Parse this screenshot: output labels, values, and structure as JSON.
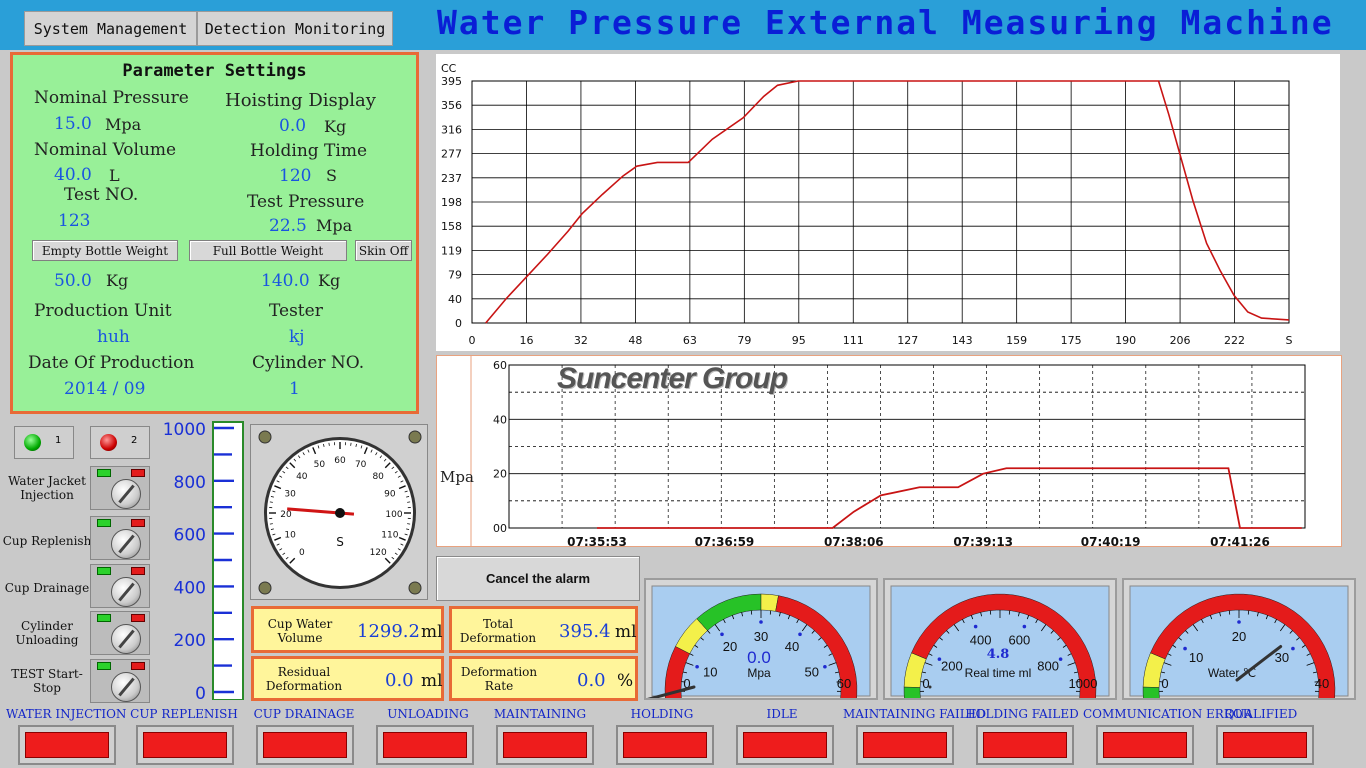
{
  "menu": {
    "system_management": "System Management",
    "detection_monitoring": "Detection Monitoring"
  },
  "app_title": "Water Pressure External Measuring Machine",
  "params": {
    "title": "Parameter Settings",
    "nominal_pressure_label": "Nominal Pressure",
    "nominal_pressure_value": "15.0",
    "nominal_pressure_unit": "Mpa",
    "hoisting_display_label": "Hoisting Display",
    "hoisting_display_value": "0.0",
    "hoisting_display_unit": "Kg",
    "nominal_volume_label": "Nominal Volume",
    "nominal_volume_value": "40.0",
    "nominal_volume_unit": "L",
    "holding_time_label": "Holding Time",
    "holding_time_value": "120",
    "holding_time_unit": "S",
    "test_no_label": "Test NO.",
    "test_no_value": "123",
    "test_pressure_label": "Test Pressure",
    "test_pressure_value": "22.5",
    "test_pressure_unit": "Mpa",
    "empty_bottle_btn": "Empty Bottle Weight",
    "full_bottle_btn": "Full Bottle Weight",
    "skin_off_btn": "Skin Off",
    "empty_bottle_value": "50.0",
    "empty_bottle_unit": "Kg",
    "full_bottle_value": "140.0",
    "full_bottle_unit": "Kg",
    "production_unit_label": "Production Unit",
    "production_unit_value": "huh",
    "tester_label": "Tester",
    "tester_value": "kj",
    "date_label": "Date Of Production",
    "date_value": "2014 / 09",
    "cylinder_label": "Cylinder NO.",
    "cylinder_value": "1"
  },
  "controls": {
    "btn1": "1",
    "btn2": "2",
    "items": [
      "Water Jacket Injection",
      "Cup Replenish",
      "Cup Drainage",
      "Cylinder Unloading",
      "TEST Start-Stop"
    ]
  },
  "level_gauge": {
    "ticks": [
      "1000",
      "800",
      "600",
      "400",
      "200",
      "0"
    ]
  },
  "dial": {
    "labels": [
      "0",
      "10",
      "20",
      "30",
      "40",
      "50",
      "60",
      "70",
      "80",
      "90",
      "100",
      "110",
      "120"
    ],
    "unit": "S",
    "value_seconds": 22
  },
  "readouts": {
    "cup_water_volume_label": "Cup Water Volume",
    "cup_water_volume_value": "1299.2",
    "cup_water_volume_unit": "ml",
    "total_deformation_label": "Total Deformation",
    "total_deformation_value": "395.4",
    "total_deformation_unit": "ml",
    "residual_deformation_label": "Residual Deformation",
    "residual_deformation_value": "0.0",
    "residual_deformation_unit": "ml",
    "deformation_rate_label": "Deformation Rate",
    "deformation_rate_value": "0.0",
    "deformation_rate_unit": "%"
  },
  "cancel_alarm": "Cancel the alarm",
  "watermark": "Suncenter Group",
  "gauges": [
    {
      "ticks": [
        "0",
        "10",
        "20",
        "30",
        "40",
        "50",
        "60"
      ],
      "value": "0.0",
      "unit": "Mpa"
    },
    {
      "ticks": [
        "0",
        "200",
        "400",
        "600",
        "800",
        "1000"
      ],
      "value": "4.8",
      "unit": "Real time ml"
    },
    {
      "ticks": [
        "0",
        "10",
        "20",
        "30",
        "40"
      ],
      "unit": "Water ℃"
    }
  ],
  "status": [
    "WATER INJECTION",
    "CUP REPLENISH",
    "CUP DRAINAGE",
    "UNLOADING",
    "MAINTAINING",
    "HOLDING",
    "IDLE",
    "MAINTAINING FAILED",
    "HOLDING FAILED",
    "COMMUNICATION ERROR",
    "QUALIFIED"
  ],
  "status_colors": {
    "lamp": "#ee1c1c",
    "label": "#1326c8"
  },
  "chart_data": [
    {
      "type": "line",
      "ylabel": "CC",
      "xlabel": "S",
      "xlim": [
        0,
        238
      ],
      "ylim": [
        0,
        395
      ],
      "x_ticks": [
        "0",
        "16",
        "32",
        "48",
        "63",
        "79",
        "95",
        "111",
        "127",
        "143",
        "159",
        "175",
        "190",
        "206",
        "222",
        "S"
      ],
      "y_ticks": [
        "395",
        "356",
        "316",
        "277",
        "237",
        "198",
        "158",
        "119",
        "79",
        "40",
        "0"
      ],
      "grid": true,
      "series": [
        {
          "color": "#c81414",
          "x": [
            4,
            10,
            16,
            22,
            28,
            32,
            38,
            44,
            48,
            54,
            63,
            70,
            79,
            85,
            89,
            95,
            111,
            127,
            143,
            159,
            175,
            190,
            200,
            203,
            206,
            210,
            214,
            218,
            222,
            226,
            230,
            238
          ],
          "y": [
            0,
            40,
            76,
            112,
            150,
            178,
            210,
            240,
            256,
            262,
            262,
            300,
            335,
            370,
            388,
            395,
            395,
            395,
            395,
            395,
            395,
            395,
            395,
            340,
            280,
            200,
            130,
            85,
            45,
            18,
            8,
            5
          ]
        }
      ]
    },
    {
      "type": "line",
      "ylabel": "Mpa",
      "ylim": [
        0,
        60
      ],
      "y_ticks": [
        "60",
        "40",
        "20",
        "00"
      ],
      "x_ticks": [
        "07:35:53",
        "07:36:59",
        "07:38:06",
        "07:39:13",
        "07:40:19",
        "07:41:26"
      ],
      "grid": true,
      "series": [
        {
          "color": "#c81414",
          "x": [
            "07:35:53",
            "07:37:55",
            "07:38:06",
            "07:38:20",
            "07:38:40",
            "07:39:00",
            "07:39:13",
            "07:39:25",
            "07:40:30",
            "07:41:20",
            "07:41:26",
            "07:41:58"
          ],
          "y": [
            0,
            0,
            6,
            12,
            15,
            15,
            20,
            22,
            22,
            22,
            0,
            0
          ]
        }
      ]
    }
  ]
}
